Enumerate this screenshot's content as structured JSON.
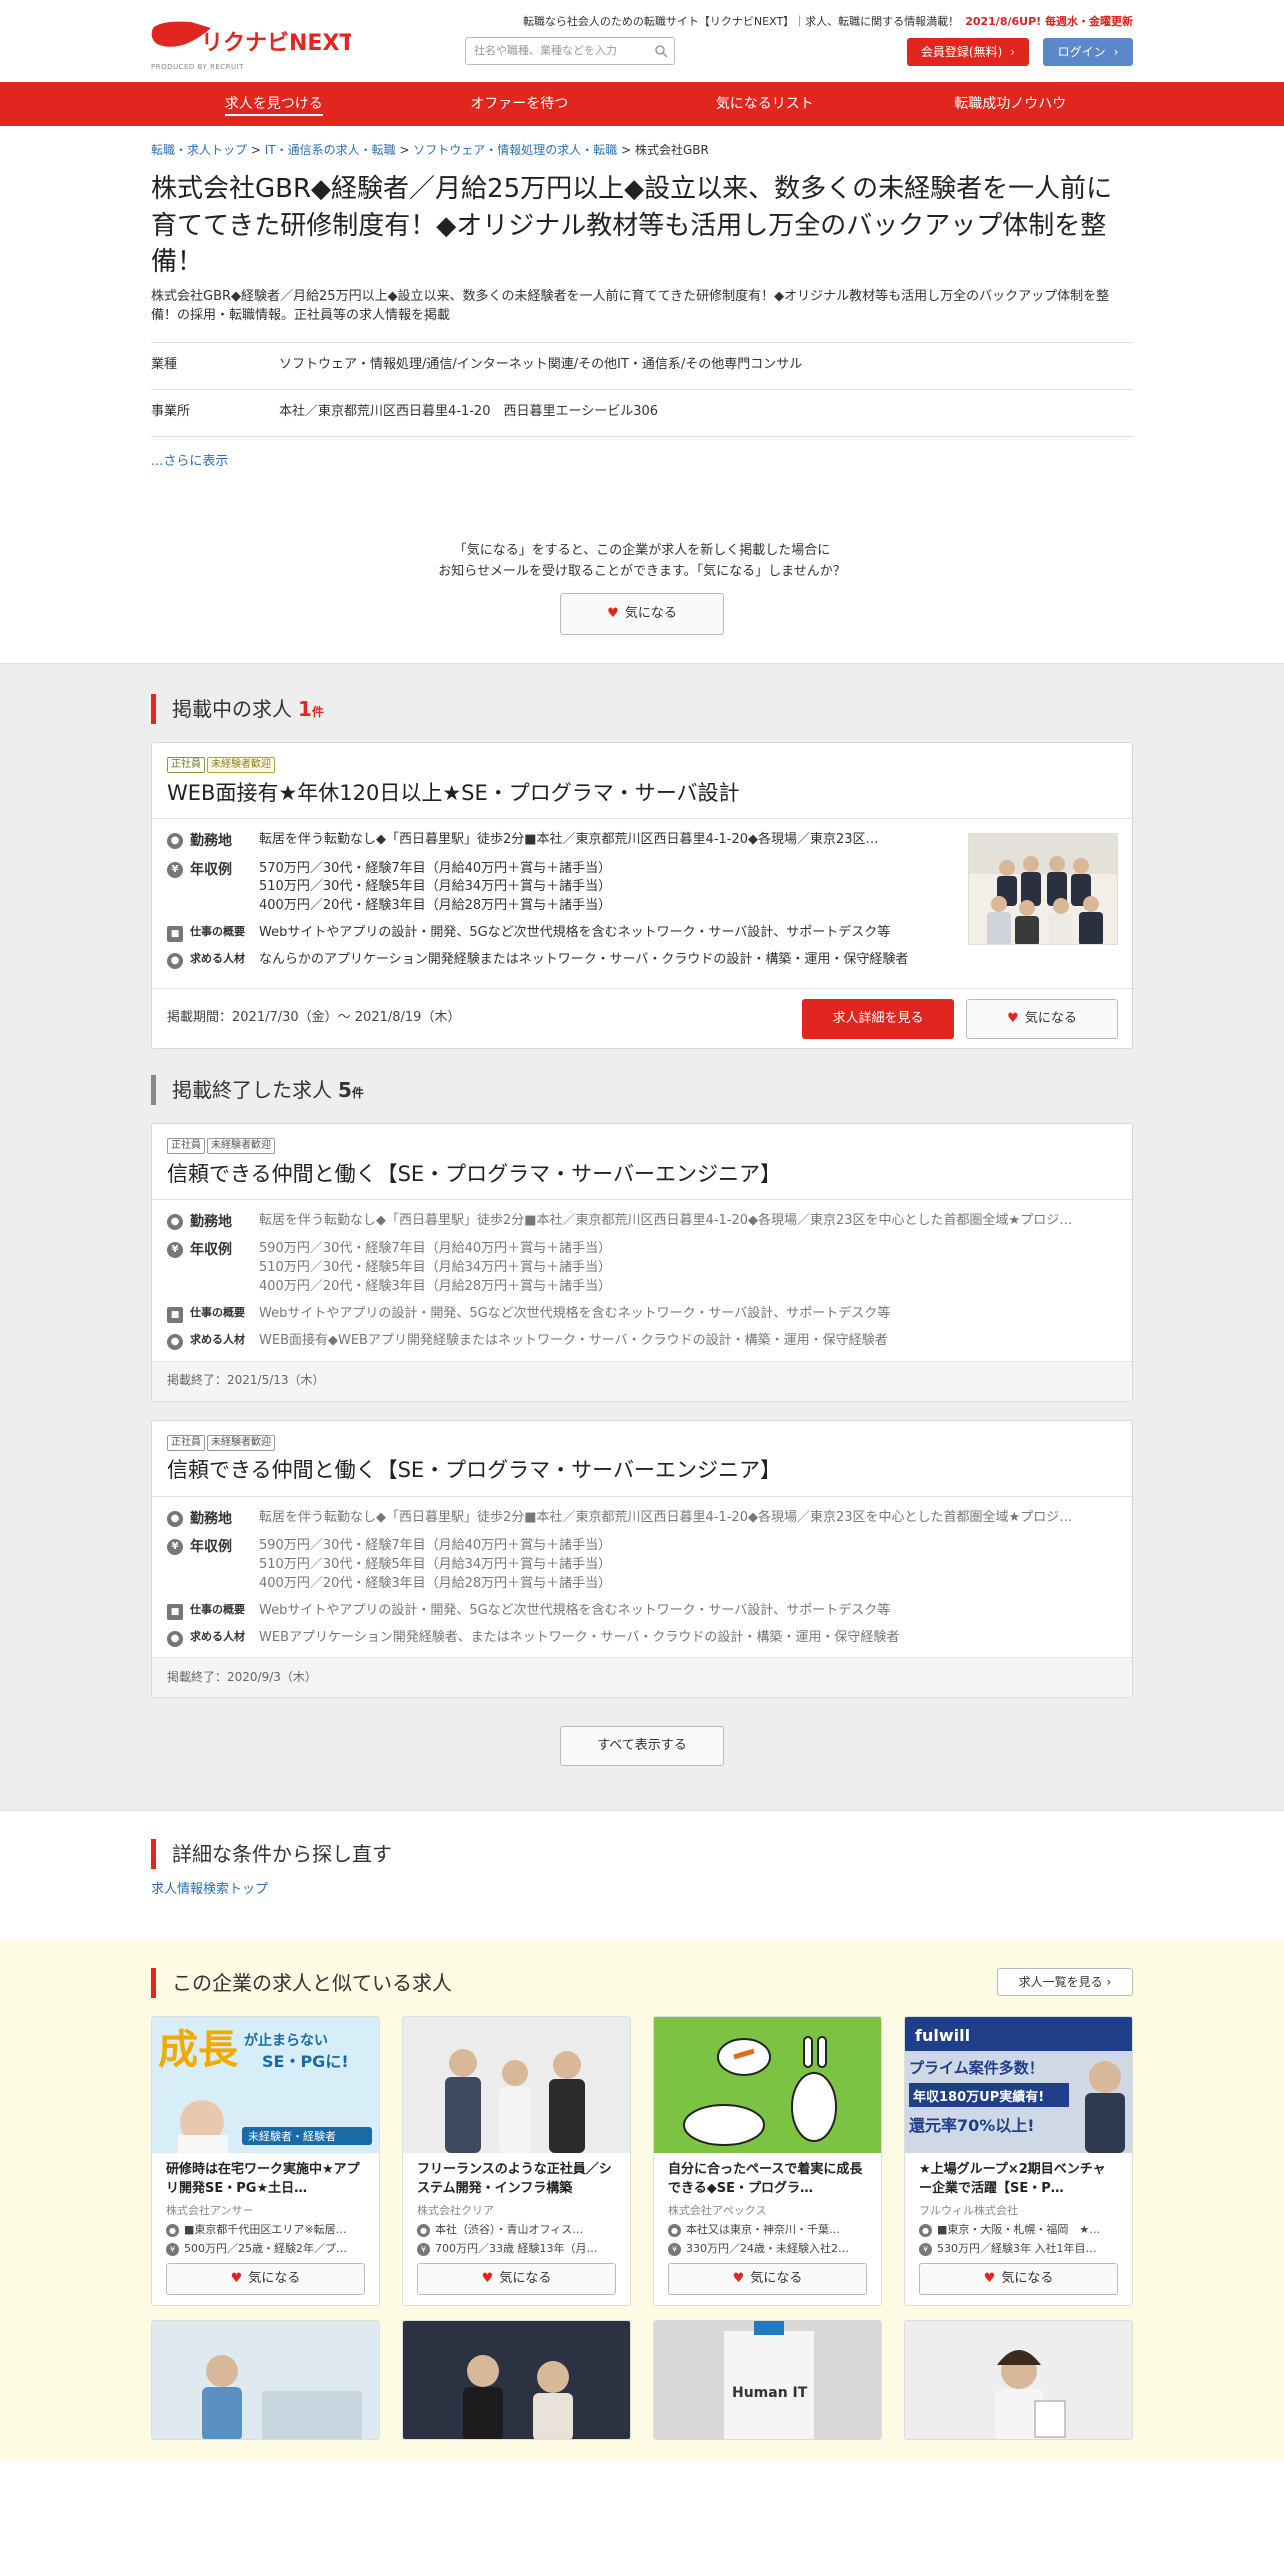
{
  "header": {
    "logo_text": "リクナビNEXT",
    "logo_sub": "PRODUCED BY RECRUIT",
    "search_placeholder": "社名や職種、業種などを入力",
    "tagline": "転職なら社会人のための転職サイト【リクナビNEXT】｜求人、転職に関する情報満載！",
    "update": "2021/8/6UP! 毎週水・金曜更新",
    "register_label": "会員登録(無料)",
    "login_label": "ログイン"
  },
  "nav": [
    "求人を見つける",
    "オファーを待つ",
    "気になるリスト",
    "転職成功ノウハウ"
  ],
  "breadcrumb": [
    "転職・求人トップ",
    "IT・通信系の求人・転職",
    "ソフトウェア・情報処理の求人・転職",
    "株式会社GBR"
  ],
  "company": {
    "title": "株式会社GBR◆経験者／月給25万円以上◆設立以来、数多くの未経験者を一人前に育ててきた研修制度有！◆オリジナル教材等も活用し万全のバックアップ体制を整備！",
    "description": "株式会社GBR◆経験者／月給25万円以上◆設立以来、数多くの未経験者を一人前に育ててきた研修制度有！◆オリジナル教材等も活用し万全のバックアップ体制を整備！の採用・転職情報。正社員等の求人情報を掲載",
    "info": [
      {
        "key": "業種",
        "value": "ソフトウェア・情報処理/通信/インターネット関連/その他IT・通信系/その他専門コンサル"
      },
      {
        "key": "事業所",
        "value": "本社／東京都荒川区西日暮里4-1-20　西日暮里エーシービル306"
      }
    ],
    "more_label": "...さらに表示"
  },
  "favorite_prompt": {
    "line1": "「気になる」をすると、この企業が求人を新しく掲載した場合に",
    "line2": "お知らせメールを受け取ることができます。「気になる」しませんか？",
    "button": "気になる"
  },
  "active_jobs": {
    "title": "掲載中の求人",
    "count": "1",
    "count_unit": "件",
    "jobs": [
      {
        "tags": [
          "正社員",
          "未経験者歓迎"
        ],
        "title": "WEB面接有★年休120日以上★SE・プログラマ・サーバ設計",
        "location_label": "勤務地",
        "location": "転居を伴う転勤なし◆「西日暮里駅」徒歩2分■本社／東京都荒川区西日暮里4-1-20◆各現場／東京23区…",
        "salary_label": "年収例",
        "salary": [
          "570万円／30代・経験7年目（月給40万円＋賞与＋諸手当）",
          "510万円／30代・経験5年目（月給34万円＋賞与＋諸手当）",
          "400万円／20代・経験3年目（月給28万円＋賞与＋諸手当）"
        ],
        "work_label": "仕事の概要",
        "work": "Webサイトやアプリの設計・開発、5Gなど次世代規格を含むネットワーク・サーバ設計、サポートデスク等",
        "req_label": "求める人材",
        "req": "なんらかのアプリケーション開発経験またはネットワーク・サーバ・クラウドの設計・構築・運用・保守経験者",
        "period": "掲載期間：2021/7/30（金）～ 2021/8/19（木）",
        "detail_button": "求人詳細を見る",
        "fav_button": "気になる"
      }
    ]
  },
  "ended_jobs": {
    "title": "掲載終了した求人",
    "count": "5",
    "count_unit": "件",
    "jobs": [
      {
        "tags": [
          "正社員",
          "未経験者歓迎"
        ],
        "title": "信頼できる仲間と働く【SE・プログラマ・サーバーエンジニア】",
        "location_label": "勤務地",
        "location": "転居を伴う転勤なし◆「西日暮里駅」徒歩2分■本社／東京都荒川区西日暮里4-1-20◆各現場／東京23区を中心とした首都圏全域★プロジ…",
        "salary_label": "年収例",
        "salary": [
          "590万円／30代・経験7年目（月給40万円＋賞与＋諸手当）",
          "510万円／30代・経験5年目（月給34万円＋賞与＋諸手当）",
          "400万円／20代・経験3年目（月給28万円＋賞与＋諸手当）"
        ],
        "work_label": "仕事の概要",
        "work": "Webサイトやアプリの設計・開発、5Gなど次世代規格を含むネットワーク・サーバ設計、サポートデスク等",
        "req_label": "求める人材",
        "req": "WEB面接有◆WEBアプリ開発経験またはネットワーク・サーバ・クラウドの設計・構築・運用・保守経験者",
        "ended": "掲載終了：2021/5/13（木）"
      },
      {
        "tags": [
          "正社員",
          "未経験者歓迎"
        ],
        "title": "信頼できる仲間と働く【SE・プログラマ・サーバーエンジニア】",
        "location_label": "勤務地",
        "location": "転居を伴う転勤なし◆「西日暮里駅」徒歩2分■本社／東京都荒川区西日暮里4-1-20◆各現場／東京23区を中心とした首都圏全域★プロジ…",
        "salary_label": "年収例",
        "salary": [
          "590万円／30代・経験7年目（月給40万円＋賞与＋諸手当）",
          "510万円／30代・経験5年目（月給34万円＋賞与＋諸手当）",
          "400万円／20代・経験3年目（月給28万円＋賞与＋諸手当）"
        ],
        "work_label": "仕事の概要",
        "work": "Webサイトやアプリの設計・開発、5Gなど次世代規格を含むネットワーク・サーバ設計、サポートデスク等",
        "req_label": "求める人材",
        "req": "WEBアプリケーション開発経験者、またはネットワーク・サーバ・クラウドの設計・構築・運用・保守経験者",
        "ended": "掲載終了：2020/9/3（木）"
      }
    ],
    "show_all": "すべて表示する"
  },
  "search_again": {
    "title": "詳細な条件から探し直す",
    "link": "求人情報検索トップ"
  },
  "similar": {
    "title": "この企業の求人と似ている求人",
    "list_button": "求人一覧を見る",
    "cards": [
      {
        "title": "研修時は在宅ワーク実施中★アプリ開発SE・PG★土日…",
        "company": "株式会社アンサー",
        "loc": "■東京都千代田区エリア※転居…",
        "sal": "500万円／25歳・経験2年／プ…",
        "img_text1": "成長",
        "img_text2": "が止まらない",
        "img_text3": "SE・PGに!",
        "img_text4": "未経験者・経験者",
        "fav": "気になる"
      },
      {
        "title": "フリーランスのような正社員／システム開発・インフラ構築",
        "company": "株式会社クリア",
        "loc": "本社（渋谷）・青山オフィス…",
        "sal": "700万円／33歳 経験13年（月…",
        "fav": "気になる"
      },
      {
        "title": "自分に合ったペースで着実に成長できる◆SE・プログラ…",
        "company": "株式会社アペックス",
        "loc": "本社又は東京・神奈川・千葉…",
        "sal": "330万円／24歳・未経験入社2…",
        "fav": "気になる"
      },
      {
        "title": "★上場グループ×2期目ベンチャー企業で活躍【SE・P…",
        "company": "フルウィル株式会社",
        "loc": "■東京・大阪・札幌・福岡　★…",
        "sal": "530万円／経験3年 入社1年目…",
        "img_text1": "fulwill",
        "img_text2": "プライム案件多数！",
        "img_text3": "年収180万UP実績有!",
        "img_text4": "還元率70%以上!",
        "fav": "気になる"
      }
    ],
    "row2_text": "Human IT"
  }
}
